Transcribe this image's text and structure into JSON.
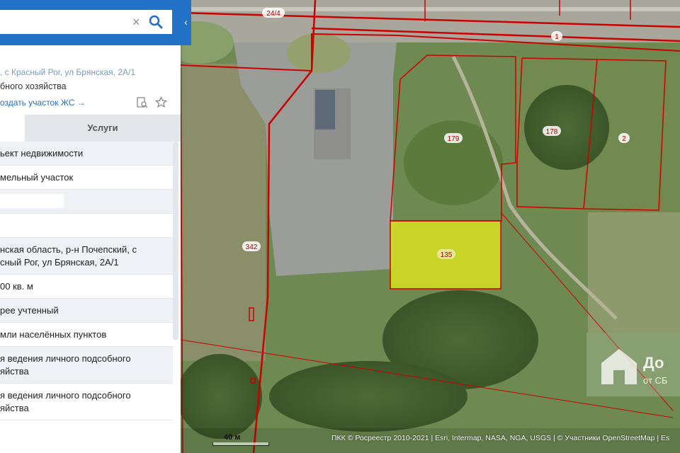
{
  "search": {
    "value": "",
    "clear_icon": "close-icon",
    "search_icon": "search-icon"
  },
  "collapse_icon": "chevron-left-icon",
  "collapse_glyph": "‹",
  "card": {
    "address": ", с Красный Рог, ул Брянская, 2А/1",
    "purpose": "бного хозяйства",
    "create_link": "оздать участок ЖС →"
  },
  "tabs": {
    "services": "Услуги"
  },
  "rows": [
    "ьект недвижимости",
    "мельный участок",
    "",
    "",
    "нская область, р-н Почепский, с\nсный Рог, ул Брянская, 2А/1",
    "00 кв. м",
    "рее учтенный",
    "мли населённых пунктов",
    "я ведения личного подсобного\nяйства",
    "я ведения личного подсобного\nяйства"
  ],
  "map": {
    "parcel_labels": [
      "24/4",
      "1",
      "179",
      "178",
      "2",
      "342",
      "135"
    ],
    "highlight_color": "#d9e021",
    "boundary_color": "#cc0000"
  },
  "scale_label": "40 м",
  "attribution": "ПКК © Росреестр 2010-2021 | Esri, Intermap, NASA, NGA, USGS | © Участники OpenStreetMap | Es",
  "logo": {
    "line1": "До",
    "line2": "от СБ"
  }
}
